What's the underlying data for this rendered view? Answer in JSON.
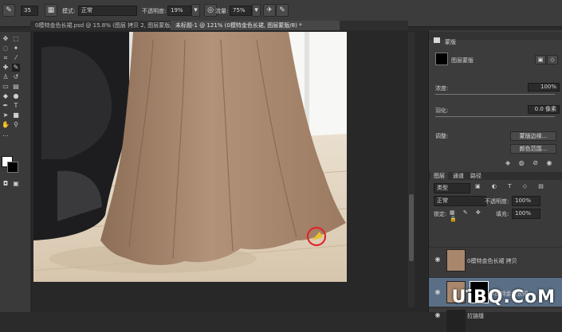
{
  "options_bar": {
    "brush_size": "35",
    "mode_label": "模式:",
    "mode_value": "正常",
    "opacity_label": "不透明度:",
    "opacity_value": "19%",
    "flow_label": "流量:",
    "flow_value": "75%"
  },
  "tabs": [
    {
      "label": "0模特金色长裙.psd @ 15.8% (图层 拷贝 2, 图层蒙版/8) *"
    },
    {
      "label": "未标题-1 @ 121% (0模特金色长裙, 图层蒙版/8) *"
    }
  ],
  "properties": {
    "title": "蒙版",
    "layer_mask_label": "图层蒙版",
    "density_label": "浓度:",
    "density_value": "100%",
    "feather_label": "羽化:",
    "feather_value": "0.0 像素",
    "adjust_label": "调整:",
    "mask_edge_button": "蒙版边缘...",
    "color_range_button": "颜色范围..."
  },
  "layers_panel": {
    "tabs": [
      "图层",
      "通道",
      "路径"
    ],
    "kind_filter": "类型",
    "blend_mode": "正常",
    "opacity_label": "不透明度:",
    "opacity_value": "100%",
    "lock_label": "锁定:",
    "fill_label": "填充:",
    "fill_value": "100%",
    "layers": [
      {
        "name": "0模特金色长裙 拷贝"
      },
      {
        "name": "0模特金色长裙"
      },
      {
        "name": "拉链缝"
      }
    ]
  },
  "watermark": "UiBQ.CoM",
  "colors": {
    "panel_bg": "#3c3c3c",
    "selection": "#5a6f86",
    "dress": "#a8876c",
    "floor": "#e6d9c6",
    "highlight_circle": "#e0262a"
  }
}
